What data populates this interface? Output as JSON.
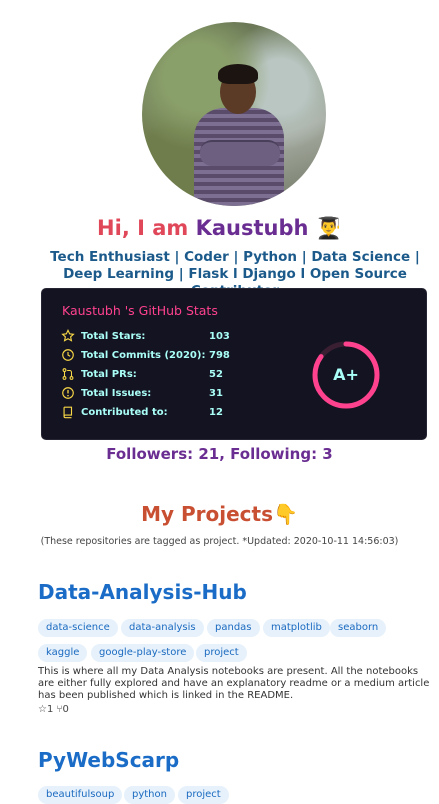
{
  "profile": {
    "greeting": "Hi, I am ",
    "name": "Kaustubh",
    "emoji": "👨‍🎓",
    "tagline": "Tech Enthusiast | Coder | Python | Data Science | Deep Learning | Flask l Django l Open Source Contributor"
  },
  "stats_card": {
    "title": "Kaustubh 's GitHub Stats",
    "rows": [
      {
        "label": "Total Stars:",
        "value": "103",
        "icon": "star-icon"
      },
      {
        "label": "Total Commits (2020):",
        "value": "798",
        "icon": "clock-icon"
      },
      {
        "label": "Total PRs:",
        "value": "52",
        "icon": "pull-request-icon"
      },
      {
        "label": "Total Issues:",
        "value": "31",
        "icon": "issue-icon"
      },
      {
        "label": "Contributed to:",
        "value": "12",
        "icon": "book-icon"
      }
    ],
    "grade": "A+",
    "grade_progress": 0.85,
    "colors": {
      "bg": "#141321",
      "title": "#fe428e",
      "text": "#a9fef7",
      "ring": "#fe428e",
      "icon": "#f8d847"
    }
  },
  "follow_text": "Followers: 21, Following: 3",
  "projects": {
    "heading": "My Projects",
    "emoji": "👇",
    "note": "(These repositories are tagged as project. *Updated: 2020-10-11 14:56:03)"
  },
  "repos": [
    {
      "name": "Data-Analysis-Hub",
      "tags": [
        "data-science",
        "data-analysis",
        "pandas",
        "matplotlib",
        "seaborn",
        "kaggle",
        "google-play-store",
        "project"
      ],
      "description": "This is where all my Data Analysis notebooks are present. All the notebooks are either fully explored and have an explanatory readme or a medium article has been published which is linked in the README.",
      "counts": "☆1 ⑂0"
    },
    {
      "name": "PyWebScarp",
      "tags": [
        "beautifulsoup",
        "python",
        "project"
      ]
    }
  ]
}
